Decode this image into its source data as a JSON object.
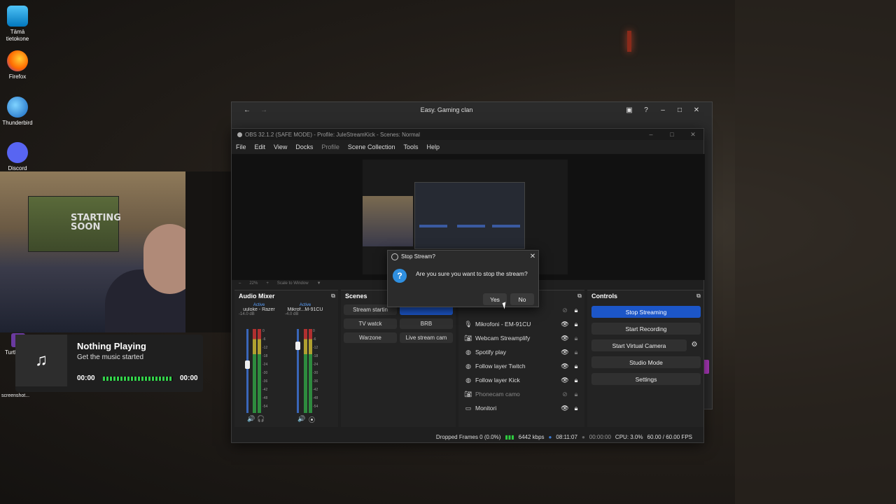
{
  "desktop": {
    "icons": [
      {
        "label": "Tämä tietokone"
      },
      {
        "label": "Firefox"
      },
      {
        "label": "Thunderbird"
      },
      {
        "label": "Discord"
      }
    ],
    "turtle_label": "Turtle Swa",
    "screenshot_label": "screenshot..."
  },
  "webcam": {
    "poster_text": "STARTING SOON"
  },
  "music": {
    "title": "Nothing Playing",
    "subtitle": "Get the music started",
    "time_current": "00:00",
    "time_total": "00:00",
    "icon": "music-note-icon"
  },
  "browser": {
    "title": "Easy. Gaming clan"
  },
  "obs": {
    "title": "OBS 32.1.2 (SAFE MODE) - Profile: JuleStreamKick - Scenes: Normal",
    "menu": [
      "File",
      "Edit",
      "View",
      "Docks",
      "Profile",
      "Scene Collection",
      "Tools",
      "Help"
    ],
    "preview_toolbar": {
      "zoom": "22%",
      "scale": "Scale to Window"
    },
    "audio_mixer": {
      "title": "Audio Mixer",
      "channels": [
        {
          "name": "uuloke - Razer",
          "active": "Active",
          "db": "-14.0 dB"
        },
        {
          "name": "Mikrof...M-91CU",
          "active": "Active",
          "db": "-4.0 dB"
        }
      ],
      "scale": [
        "0",
        "-6",
        "-12",
        "-18",
        "-24",
        "-30",
        "-36",
        "-42",
        "-48",
        "-54",
        "-60"
      ]
    },
    "scenes": {
      "title": "Scenes",
      "items": [
        "Stream startin",
        "",
        "TV watck",
        "BRB",
        "Warzone",
        "Live stream cam"
      ]
    },
    "sources": {
      "items": [
        {
          "name": "Mikrofoni - EM-91CU",
          "icon": "mic-icon"
        },
        {
          "name": "Webcam Streamplify",
          "icon": "camera-icon"
        },
        {
          "name": "Spotify play",
          "icon": "browser-icon"
        },
        {
          "name": "Follow layer Twitch",
          "icon": "browser-icon"
        },
        {
          "name": "Follow layer Kick",
          "icon": "browser-icon"
        },
        {
          "name": "Phonecam camo",
          "icon": "camera-icon"
        },
        {
          "name": "Monitori",
          "icon": "monitor-icon"
        }
      ]
    },
    "controls": {
      "title": "Controls",
      "stop_streaming": "Stop Streaming",
      "start_recording": "Start Recording",
      "start_virtual_camera": "Start Virtual Camera",
      "studio_mode": "Studio Mode",
      "settings": "Settings"
    },
    "status": {
      "dropped": "Dropped Frames 0 (0.0%)",
      "bitrate": "6442 kbps",
      "stream_time": "08:11:07",
      "rec_time": "00:00:00",
      "cpu": "CPU: 3.0%",
      "fps": "60.00 / 60.00 FPS"
    }
  },
  "dialog": {
    "title": "Stop Stream?",
    "message": "Are you sure you want to stop the stream?",
    "yes": "Yes",
    "no": "No"
  },
  "colors": {
    "accent": "#1c56c8",
    "meter_green": "#2e8b3e",
    "status_green": "#2ecc40"
  }
}
